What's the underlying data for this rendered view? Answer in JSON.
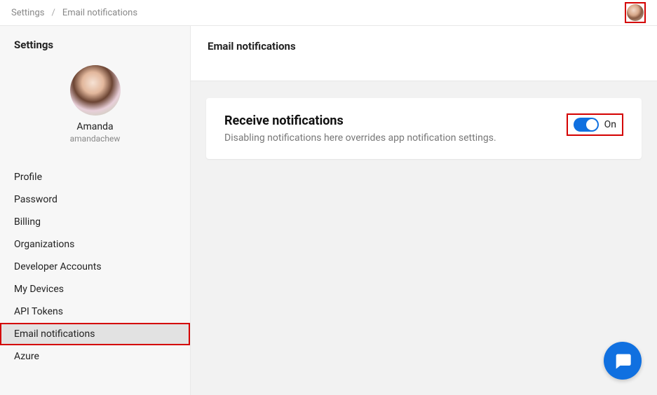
{
  "breadcrumb": {
    "root": "Settings",
    "separator": "/",
    "current": "Email notifications"
  },
  "sidebar": {
    "heading": "Settings",
    "profile": {
      "name": "Amanda",
      "username": "amandachew"
    },
    "items": [
      {
        "label": "Profile",
        "active": false
      },
      {
        "label": "Password",
        "active": false
      },
      {
        "label": "Billing",
        "active": false
      },
      {
        "label": "Organizations",
        "active": false
      },
      {
        "label": "Developer Accounts",
        "active": false
      },
      {
        "label": "My Devices",
        "active": false
      },
      {
        "label": "API Tokens",
        "active": false
      },
      {
        "label": "Email notifications",
        "active": true
      },
      {
        "label": "Azure",
        "active": false
      }
    ]
  },
  "main": {
    "title": "Email notifications",
    "card": {
      "title": "Receive notifications",
      "description": "Disabling notifications here overrides app notification settings.",
      "toggle_state_label": "On",
      "toggle_on": true
    }
  },
  "colors": {
    "accent": "#1070e0",
    "callout_border": "#d40000"
  }
}
